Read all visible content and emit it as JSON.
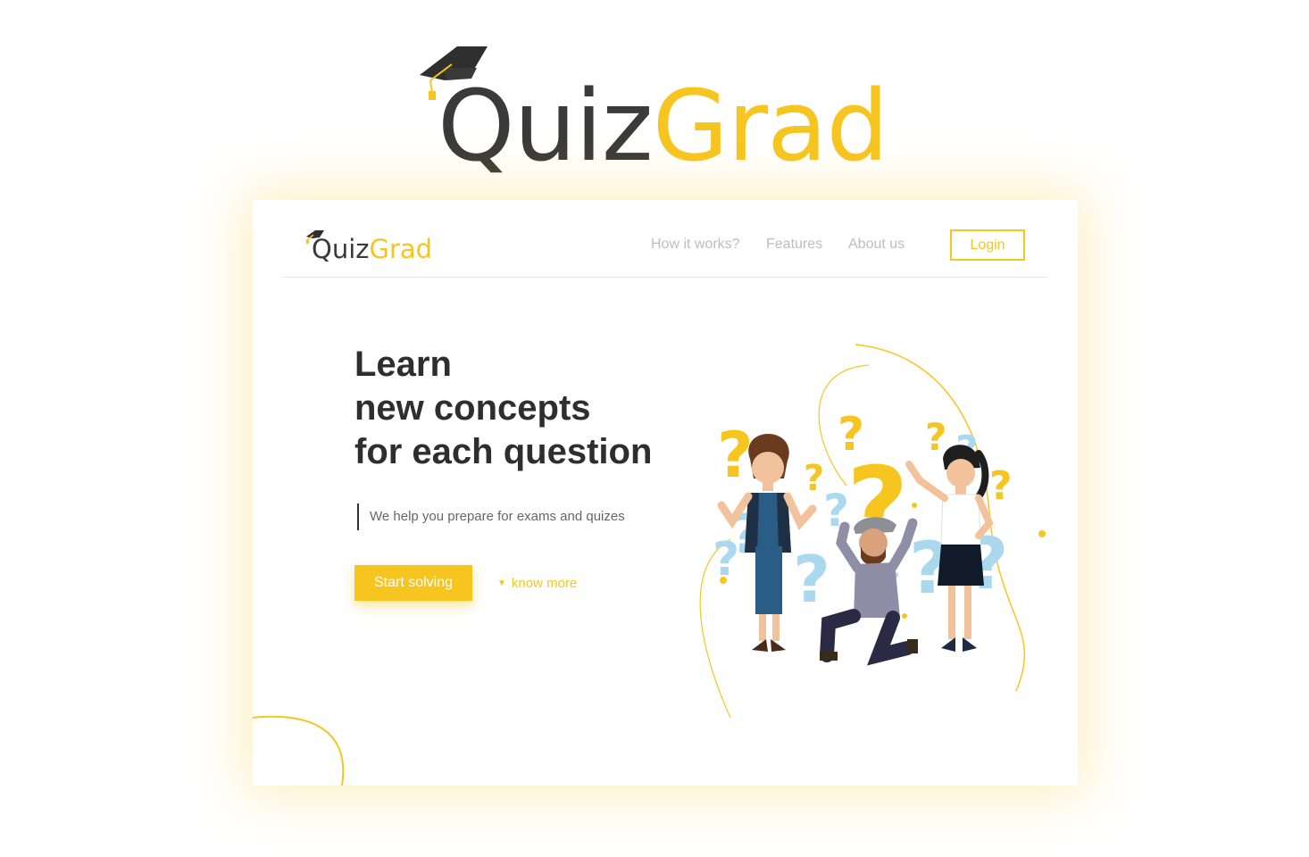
{
  "brand": {
    "name_dark": "Quiz",
    "name_yellow": "Grad",
    "color_dark": "#3a3a3a",
    "color_yellow": "#f7c520",
    "icon": "graduation-cap-icon"
  },
  "nav": {
    "links": [
      "How it works?",
      "Features",
      "About us"
    ],
    "login_label": "Login"
  },
  "hero": {
    "headline": [
      "Learn",
      "new concepts",
      "for each question"
    ],
    "subtitle": "We help you prepare for exams and quizes",
    "primary_cta": "Start solving",
    "secondary_cta": "know more",
    "secondary_icon": "caret-down-icon"
  },
  "illustration": {
    "subject": "people-with-question-marks",
    "accent_blue": "#a9d8ef"
  }
}
